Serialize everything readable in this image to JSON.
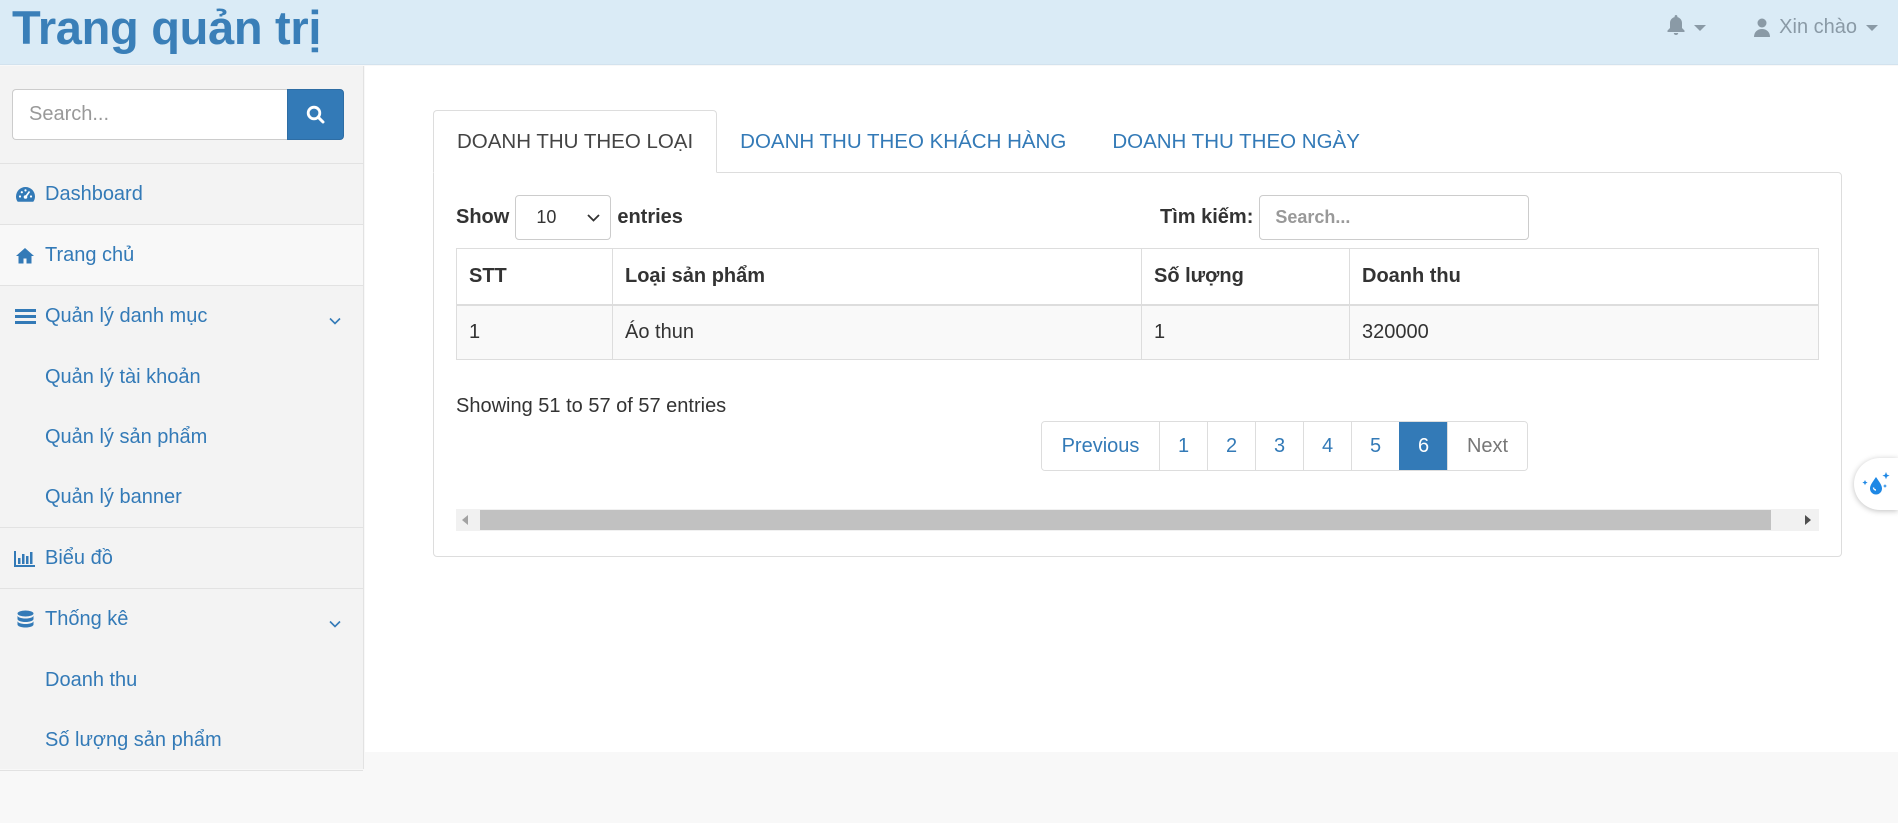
{
  "brand": {
    "title": "Trang quản trị"
  },
  "topnav": {
    "notifications_icon": "bell-icon",
    "user_icon": "user-icon",
    "greeting": "Xin chào"
  },
  "sidebar": {
    "search": {
      "placeholder": "Search..."
    },
    "items": [
      {
        "label": "Dashboard",
        "icon": "dashboard-icon"
      },
      {
        "label": "Trang chủ",
        "icon": "home-icon"
      },
      {
        "label": "Quản lý danh mục",
        "icon": "list-icon",
        "children": [
          "Quản lý tài khoản",
          "Quản lý sản phẩm",
          "Quản lý banner"
        ]
      },
      {
        "label": "Biểu đồ",
        "icon": "bar-chart-icon"
      },
      {
        "label": "Thống kê",
        "icon": "database-icon",
        "children": [
          "Doanh thu",
          "Số lượng sản phẩm"
        ]
      }
    ]
  },
  "main": {
    "tabs": [
      {
        "label": "DOANH THU THEO LOẠI",
        "active": true
      },
      {
        "label": "DOANH THU THEO KHÁCH HÀNG",
        "active": false
      },
      {
        "label": "DOANH THU THEO NGÀY",
        "active": false
      }
    ],
    "length": {
      "show": "Show",
      "value": "10",
      "entries": "entries"
    },
    "filter": {
      "label": "Tìm kiếm:",
      "placeholder": "Search..."
    },
    "table": {
      "columns": [
        "STT",
        "Loại sản phẩm",
        "Số lượng",
        "Doanh thu"
      ],
      "rows": [
        [
          "1",
          "Áo thun",
          "1",
          "320000"
        ]
      ]
    },
    "info": "Showing 51 to 57 of 57 entries",
    "pagination": {
      "previous": "Previous",
      "pages": [
        "1",
        "2",
        "3",
        "4",
        "5",
        "6"
      ],
      "current": "6",
      "next": "Next"
    }
  },
  "colors": {
    "accent": "#337ab7",
    "header_bg": "#daebf6",
    "brand_text": "#3a7fb8"
  }
}
